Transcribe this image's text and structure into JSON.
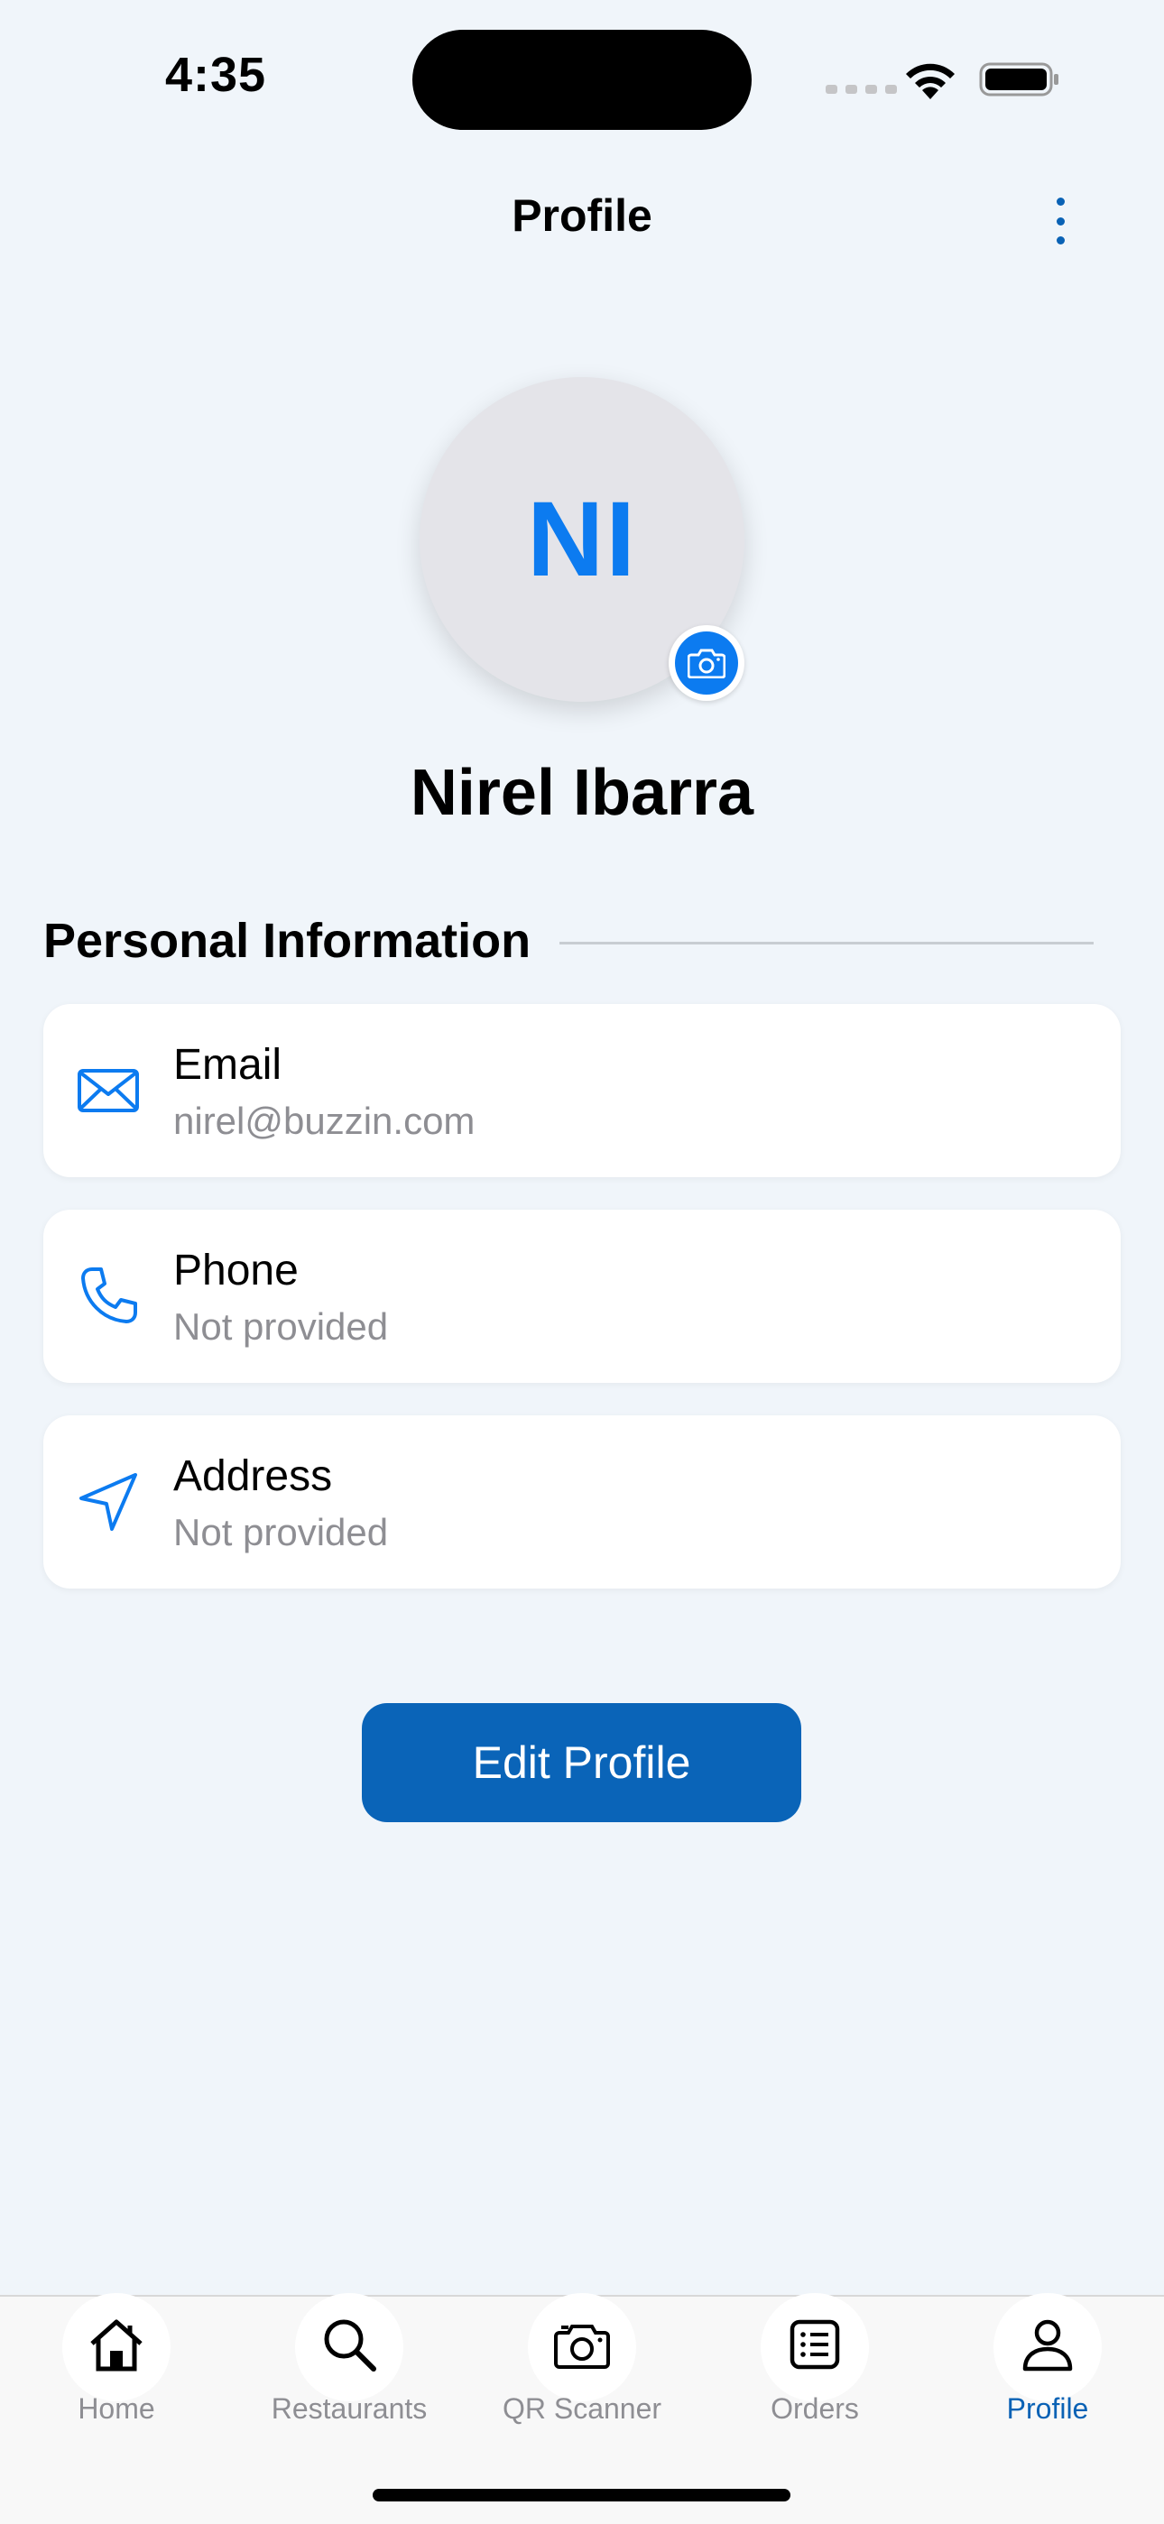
{
  "status_bar": {
    "time": "4:35"
  },
  "header": {
    "title": "Profile",
    "menu_icon": "more-vertical-icon"
  },
  "profile": {
    "initials": "NI",
    "name": "Nirel Ibarra",
    "avatar_badge_icon": "camera-icon"
  },
  "section": {
    "title": "Personal Information"
  },
  "info_items": [
    {
      "icon": "mail-icon",
      "label": "Email",
      "value": "nirel@buzzin.com"
    },
    {
      "icon": "phone-icon",
      "label": "Phone",
      "value": "Not provided"
    },
    {
      "icon": "location-arrow-icon",
      "label": "Address",
      "value": "Not provided"
    }
  ],
  "actions": {
    "edit_label": "Edit Profile"
  },
  "tab_bar": {
    "active": "Profile",
    "tabs": [
      {
        "label": "Home",
        "icon": "home-icon"
      },
      {
        "label": "Restaurants",
        "icon": "search-icon"
      },
      {
        "label": "QR Scanner",
        "icon": "camera-icon"
      },
      {
        "label": "Orders",
        "icon": "list-icon"
      },
      {
        "label": "Profile",
        "icon": "person-icon"
      }
    ]
  },
  "colors": {
    "accent": "#0C7BF0",
    "button": "#0A64B8",
    "background": "#F0F5FA",
    "muted_text": "#8E8E93"
  }
}
